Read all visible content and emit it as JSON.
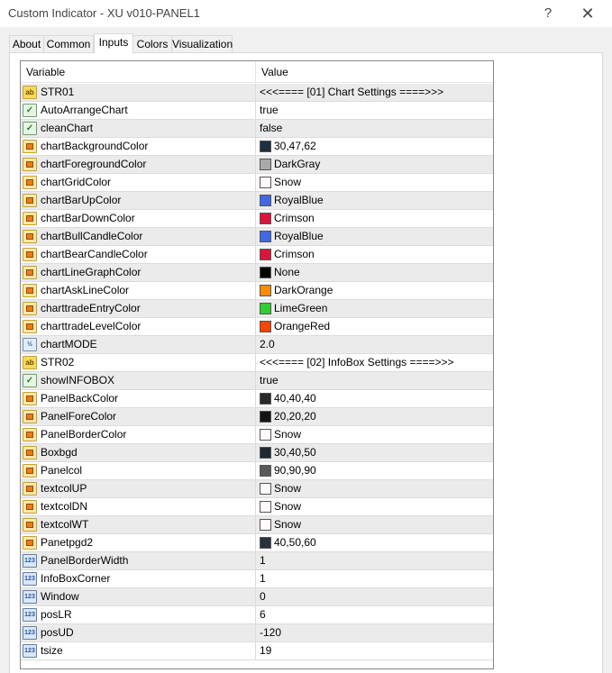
{
  "window": {
    "title": "Custom Indicator - XU v010-PANEL1",
    "help_glyph": "?",
    "close_glyph": "✕"
  },
  "tabs": [
    {
      "label": "About"
    },
    {
      "label": "Common"
    },
    {
      "label": "Inputs"
    },
    {
      "label": "Colors"
    },
    {
      "label": "Visualization"
    }
  ],
  "active_tab": "Inputs",
  "grid": {
    "col_variable": "Variable",
    "col_value": "Value",
    "rows": [
      {
        "name": "STR01",
        "type": "string",
        "value": "<<<==== [01] Chart Settings ====>>>"
      },
      {
        "name": "AutoArrangeChart",
        "type": "bool",
        "value": "true"
      },
      {
        "name": "cleanChart",
        "type": "bool",
        "value": "false"
      },
      {
        "name": "chartBackgroundColor",
        "type": "color",
        "value": "30,47,62",
        "swatch": "#1e2f3e"
      },
      {
        "name": "chartForegroundColor",
        "type": "color",
        "value": "DarkGray",
        "swatch": "#a9a9a9"
      },
      {
        "name": "chartGridColor",
        "type": "color",
        "value": "Snow",
        "swatch": "#fffafa"
      },
      {
        "name": "chartBarUpColor",
        "type": "color",
        "value": "RoyalBlue",
        "swatch": "#4169e1"
      },
      {
        "name": "chartBarDownColor",
        "type": "color",
        "value": "Crimson",
        "swatch": "#dc143c"
      },
      {
        "name": "chartBullCandleColor",
        "type": "color",
        "value": "RoyalBlue",
        "swatch": "#4169e1"
      },
      {
        "name": "chartBearCandleColor",
        "type": "color",
        "value": "Crimson",
        "swatch": "#dc143c"
      },
      {
        "name": "chartLineGraphColor",
        "type": "color",
        "value": "None",
        "swatch": "#000000"
      },
      {
        "name": "chartAskLineColor",
        "type": "color",
        "value": "DarkOrange",
        "swatch": "#ff8c00"
      },
      {
        "name": "charttradeEntryColor",
        "type": "color",
        "value": "LimeGreen",
        "swatch": "#32cd32"
      },
      {
        "name": "charttradeLevelColor",
        "type": "color",
        "value": "OrangeRed",
        "swatch": "#ff4500"
      },
      {
        "name": "chartMODE",
        "type": "double",
        "value": "2.0"
      },
      {
        "name": "STR02",
        "type": "string",
        "value": "<<<==== [02] InfoBox Settings ====>>>"
      },
      {
        "name": "showINFOBOX",
        "type": "bool",
        "value": "true"
      },
      {
        "name": "PanelBackColor",
        "type": "color",
        "value": "40,40,40",
        "swatch": "#282828"
      },
      {
        "name": "PanelForeColor",
        "type": "color",
        "value": "20,20,20",
        "swatch": "#141414"
      },
      {
        "name": "PanelBorderColor",
        "type": "color",
        "value": "Snow",
        "swatch": "#fffafa"
      },
      {
        "name": "Boxbgd",
        "type": "color",
        "value": "30,40,50",
        "swatch": "#1e2832"
      },
      {
        "name": "Panelcol",
        "type": "color",
        "value": "90,90,90",
        "swatch": "#5a5a5a"
      },
      {
        "name": "textcolUP",
        "type": "color",
        "value": "Snow",
        "swatch": "#fffafa"
      },
      {
        "name": "textcolDN",
        "type": "color",
        "value": "Snow",
        "swatch": "#fffafa"
      },
      {
        "name": "textcolWT",
        "type": "color",
        "value": "Snow",
        "swatch": "#fffafa"
      },
      {
        "name": "Panetpgd2",
        "type": "color",
        "value": "40,50,60",
        "swatch": "#28323c"
      },
      {
        "name": "PanelBorderWidth",
        "type": "int",
        "value": "1"
      },
      {
        "name": "InfoBoxCorner",
        "type": "int",
        "value": "1"
      },
      {
        "name": "Window",
        "type": "int",
        "value": "0"
      },
      {
        "name": "posLR",
        "type": "int",
        "value": "6"
      },
      {
        "name": "posUD",
        "type": "int",
        "value": "-120"
      },
      {
        "name": "tsize",
        "type": "int",
        "value": "19"
      }
    ]
  },
  "icon_labels": {
    "string": "ab",
    "double": "½",
    "int": "123",
    "bool": "✓"
  }
}
